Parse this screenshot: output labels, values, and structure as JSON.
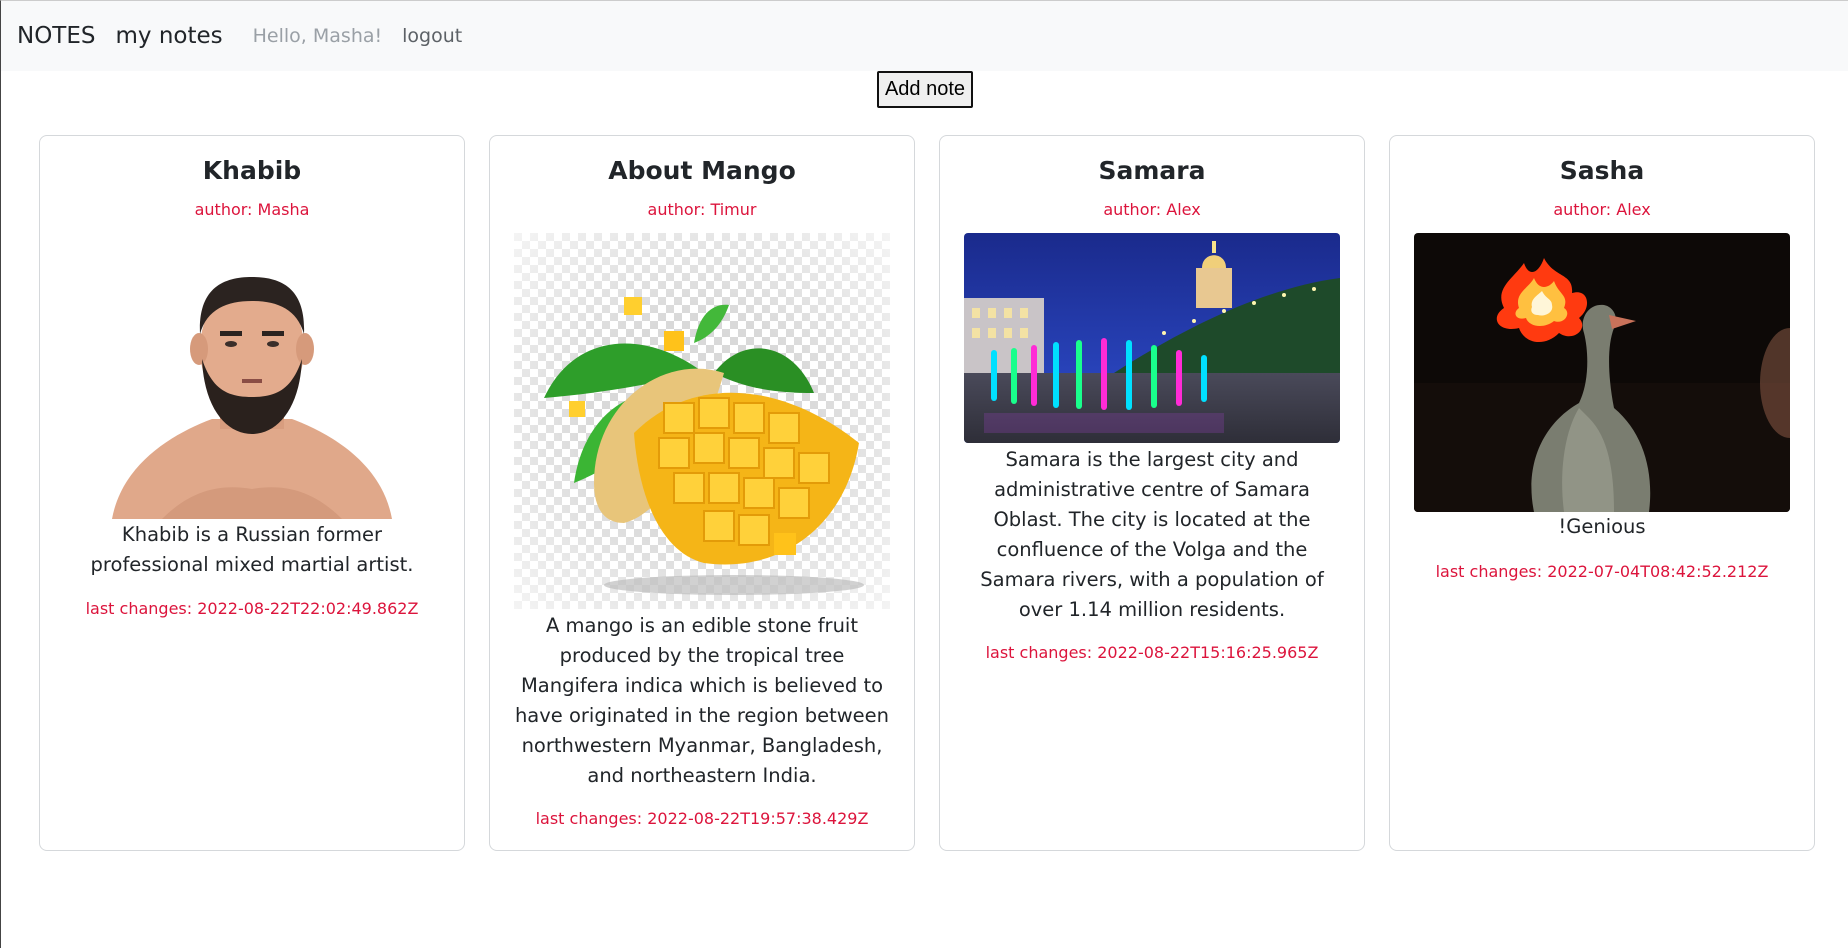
{
  "nav": {
    "brand": "NOTES",
    "my_notes": "my notes",
    "greeting": "Hello, Masha!",
    "logout": "logout"
  },
  "toolbar": {
    "add_note": "Add note"
  },
  "notes": [
    {
      "title": "Khabib",
      "author": "author: Masha",
      "text": "Khabib is a Russian former professional mixed martial artist.",
      "date": "last changes: 2022-08-22T22:02:49.862Z",
      "image": "portrait-photo"
    },
    {
      "title": "About Mango",
      "author": "author: Timur",
      "text": "A mango is an edible stone fruit produced by the tropical tree Mangifera indica which is believed to have originated in the region between northwestern Myanmar, Bangladesh, and northeastern India.",
      "date": "last changes: 2022-08-22T19:57:38.429Z",
      "image": "mango-photo"
    },
    {
      "title": "Samara",
      "author": "author: Alex",
      "text": "Samara is the largest city and administrative centre of Samara Oblast. The city is located at the confluence of the Volga and the Samara rivers, with a population of over 1.14 million residents.",
      "date": "last changes: 2022-08-22T15:16:25.965Z",
      "image": "city-night-photo"
    },
    {
      "title": "Sasha",
      "author": "author: Alex",
      "text": "!Genious",
      "date": "last changes: 2022-07-04T08:42:52.212Z",
      "image": "goose-fire-photo"
    }
  ],
  "colors": {
    "accent_red": "#dc143c",
    "navbar_bg": "#f8f9fa",
    "card_border": "#d5d8db"
  }
}
